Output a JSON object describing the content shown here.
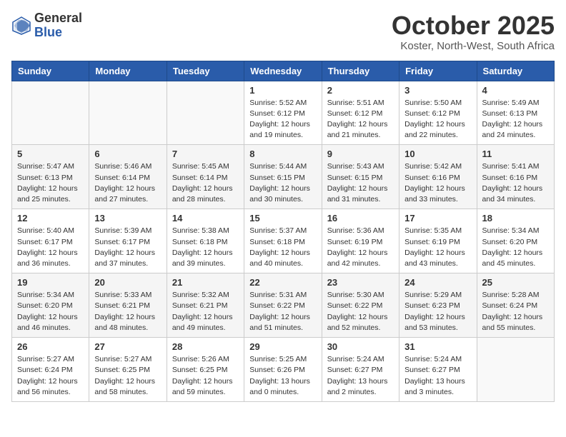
{
  "logo": {
    "general": "General",
    "blue": "Blue"
  },
  "title": "October 2025",
  "location": "Koster, North-West, South Africa",
  "days_of_week": [
    "Sunday",
    "Monday",
    "Tuesday",
    "Wednesday",
    "Thursday",
    "Friday",
    "Saturday"
  ],
  "weeks": [
    [
      {
        "day": "",
        "info": ""
      },
      {
        "day": "",
        "info": ""
      },
      {
        "day": "",
        "info": ""
      },
      {
        "day": "1",
        "info": "Sunrise: 5:52 AM\nSunset: 6:12 PM\nDaylight: 12 hours and 19 minutes."
      },
      {
        "day": "2",
        "info": "Sunrise: 5:51 AM\nSunset: 6:12 PM\nDaylight: 12 hours and 21 minutes."
      },
      {
        "day": "3",
        "info": "Sunrise: 5:50 AM\nSunset: 6:12 PM\nDaylight: 12 hours and 22 minutes."
      },
      {
        "day": "4",
        "info": "Sunrise: 5:49 AM\nSunset: 6:13 PM\nDaylight: 12 hours and 24 minutes."
      }
    ],
    [
      {
        "day": "5",
        "info": "Sunrise: 5:47 AM\nSunset: 6:13 PM\nDaylight: 12 hours and 25 minutes."
      },
      {
        "day": "6",
        "info": "Sunrise: 5:46 AM\nSunset: 6:14 PM\nDaylight: 12 hours and 27 minutes."
      },
      {
        "day": "7",
        "info": "Sunrise: 5:45 AM\nSunset: 6:14 PM\nDaylight: 12 hours and 28 minutes."
      },
      {
        "day": "8",
        "info": "Sunrise: 5:44 AM\nSunset: 6:15 PM\nDaylight: 12 hours and 30 minutes."
      },
      {
        "day": "9",
        "info": "Sunrise: 5:43 AM\nSunset: 6:15 PM\nDaylight: 12 hours and 31 minutes."
      },
      {
        "day": "10",
        "info": "Sunrise: 5:42 AM\nSunset: 6:16 PM\nDaylight: 12 hours and 33 minutes."
      },
      {
        "day": "11",
        "info": "Sunrise: 5:41 AM\nSunset: 6:16 PM\nDaylight: 12 hours and 34 minutes."
      }
    ],
    [
      {
        "day": "12",
        "info": "Sunrise: 5:40 AM\nSunset: 6:17 PM\nDaylight: 12 hours and 36 minutes."
      },
      {
        "day": "13",
        "info": "Sunrise: 5:39 AM\nSunset: 6:17 PM\nDaylight: 12 hours and 37 minutes."
      },
      {
        "day": "14",
        "info": "Sunrise: 5:38 AM\nSunset: 6:18 PM\nDaylight: 12 hours and 39 minutes."
      },
      {
        "day": "15",
        "info": "Sunrise: 5:37 AM\nSunset: 6:18 PM\nDaylight: 12 hours and 40 minutes."
      },
      {
        "day": "16",
        "info": "Sunrise: 5:36 AM\nSunset: 6:19 PM\nDaylight: 12 hours and 42 minutes."
      },
      {
        "day": "17",
        "info": "Sunrise: 5:35 AM\nSunset: 6:19 PM\nDaylight: 12 hours and 43 minutes."
      },
      {
        "day": "18",
        "info": "Sunrise: 5:34 AM\nSunset: 6:20 PM\nDaylight: 12 hours and 45 minutes."
      }
    ],
    [
      {
        "day": "19",
        "info": "Sunrise: 5:34 AM\nSunset: 6:20 PM\nDaylight: 12 hours and 46 minutes."
      },
      {
        "day": "20",
        "info": "Sunrise: 5:33 AM\nSunset: 6:21 PM\nDaylight: 12 hours and 48 minutes."
      },
      {
        "day": "21",
        "info": "Sunrise: 5:32 AM\nSunset: 6:21 PM\nDaylight: 12 hours and 49 minutes."
      },
      {
        "day": "22",
        "info": "Sunrise: 5:31 AM\nSunset: 6:22 PM\nDaylight: 12 hours and 51 minutes."
      },
      {
        "day": "23",
        "info": "Sunrise: 5:30 AM\nSunset: 6:22 PM\nDaylight: 12 hours and 52 minutes."
      },
      {
        "day": "24",
        "info": "Sunrise: 5:29 AM\nSunset: 6:23 PM\nDaylight: 12 hours and 53 minutes."
      },
      {
        "day": "25",
        "info": "Sunrise: 5:28 AM\nSunset: 6:24 PM\nDaylight: 12 hours and 55 minutes."
      }
    ],
    [
      {
        "day": "26",
        "info": "Sunrise: 5:27 AM\nSunset: 6:24 PM\nDaylight: 12 hours and 56 minutes."
      },
      {
        "day": "27",
        "info": "Sunrise: 5:27 AM\nSunset: 6:25 PM\nDaylight: 12 hours and 58 minutes."
      },
      {
        "day": "28",
        "info": "Sunrise: 5:26 AM\nSunset: 6:25 PM\nDaylight: 12 hours and 59 minutes."
      },
      {
        "day": "29",
        "info": "Sunrise: 5:25 AM\nSunset: 6:26 PM\nDaylight: 13 hours and 0 minutes."
      },
      {
        "day": "30",
        "info": "Sunrise: 5:24 AM\nSunset: 6:27 PM\nDaylight: 13 hours and 2 minutes."
      },
      {
        "day": "31",
        "info": "Sunrise: 5:24 AM\nSunset: 6:27 PM\nDaylight: 13 hours and 3 minutes."
      },
      {
        "day": "",
        "info": ""
      }
    ]
  ]
}
